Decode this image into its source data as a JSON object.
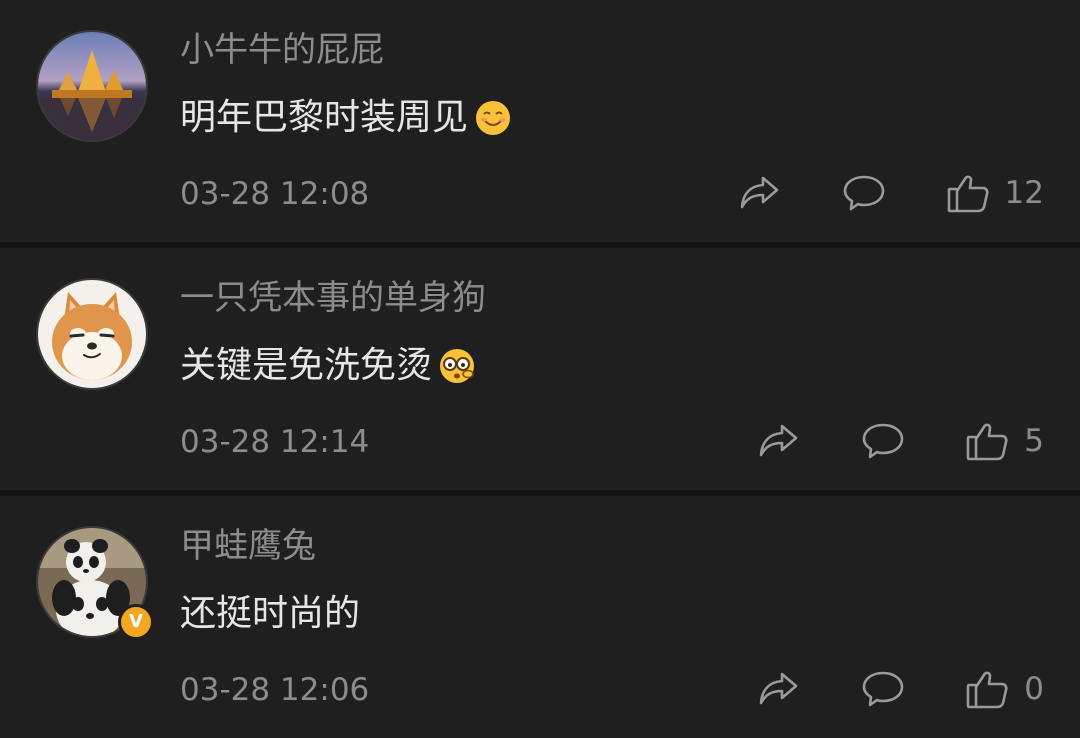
{
  "comments": [
    {
      "username": "小牛牛的屁屁",
      "text": "明年巴黎时装周见",
      "emoji": "smile-emoji",
      "time": "03-28 12:08",
      "likes": "12",
      "verified": false
    },
    {
      "username": "一只凭本事的单身狗",
      "text": "关键是免洗免烫",
      "emoji": "shocked-glasses-emoji",
      "time": "03-28 12:14",
      "likes": "5",
      "verified": false
    },
    {
      "username": "甲蛙鹰兔",
      "text": "还挺时尚的",
      "emoji": "",
      "time": "03-28 12:06",
      "likes": "0",
      "verified": true,
      "badge": "V"
    }
  ],
  "colors": {
    "background": "#1f1f1f",
    "divider": "#141414",
    "meta_text": "#8c8c8c",
    "body_text": "#e6e6e6",
    "verified_badge": "#f5a623"
  },
  "icons": [
    "share-icon",
    "comment-icon",
    "thumbs-up-icon"
  ]
}
